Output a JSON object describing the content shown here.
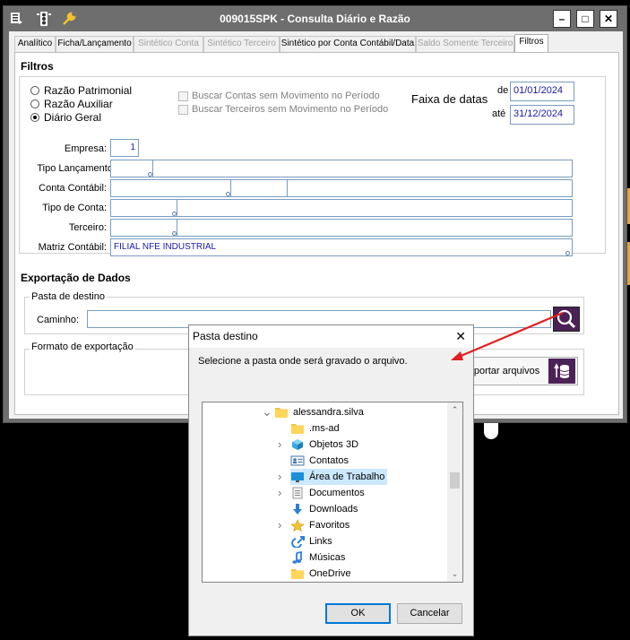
{
  "window": {
    "title": "009015SPK - Consulta Diário e Razão",
    "controls": {
      "minimize": "–",
      "maximize": "□",
      "close": "✕"
    }
  },
  "tabs": [
    {
      "label": "Analítico",
      "state": "enabled"
    },
    {
      "label": "Ficha/Lançamento",
      "state": "enabled"
    },
    {
      "label": "Sintético Conta",
      "state": "disabled"
    },
    {
      "label": "Sintético Terceiro",
      "state": "disabled"
    },
    {
      "label": "Sintético por Conta Contábil/Data",
      "state": "enabled"
    },
    {
      "label": "Saldo Somente Terceiro",
      "state": "disabled"
    },
    {
      "label": "Filtros",
      "state": "active"
    }
  ],
  "filtros": {
    "section_title": "Filtros",
    "radios": [
      {
        "label": "Razão Patrimonial",
        "checked": false
      },
      {
        "label": "Razão Auxiliar",
        "checked": false
      },
      {
        "label": "Diário Geral",
        "checked": true
      }
    ],
    "checkboxes": [
      {
        "label": "Buscar Contas sem Movimento no Período",
        "checked": false
      },
      {
        "label": "Buscar Terceiros sem Movimento no Período",
        "checked": false
      }
    ],
    "date_range": {
      "label": "Faixa de datas",
      "from_label": "de",
      "from_value": "01/01/2024",
      "to_label": "até",
      "to_value": "31/12/2024"
    },
    "fields": {
      "empresa": {
        "label": "Empresa:",
        "value": "1"
      },
      "tipo_lancamento": {
        "label": "Tipo Lançamento:",
        "value": ""
      },
      "conta_contabil": {
        "label": "Conta Contábil:",
        "value": ""
      },
      "tipo_conta": {
        "label": "Tipo de Conta:",
        "value": ""
      },
      "terceiro": {
        "label": "Terceiro:",
        "value": ""
      },
      "matriz_contabil": {
        "label": "Matriz Contábil:",
        "value": "FILIAL NFE INDUSTRIAL"
      }
    }
  },
  "exportacao": {
    "section_title": "Exportação de Dados",
    "pasta_destino": {
      "legend": "Pasta de destino",
      "caminho_label": "Caminho:",
      "caminho_value": "",
      "browse_icon": "magnifier-icon"
    },
    "formato": {
      "legend": "Formato de exportação",
      "button_label": "Exportar arquivos",
      "button_icon": "database-export-icon"
    }
  },
  "dialog": {
    "title": "Pasta destino",
    "close": "✕",
    "message": "Selecione a pasta onde será gravado o arquivo.",
    "tree": [
      {
        "label": "alessandra.silva",
        "icon": "folder-icon",
        "expanded": true,
        "selected": false
      },
      {
        "label": ".ms-ad",
        "icon": "folder-icon",
        "expanded": false,
        "selected": false
      },
      {
        "label": "Objetos 3D",
        "icon": "3d-objects-icon",
        "expanded": false,
        "selected": false
      },
      {
        "label": "Contatos",
        "icon": "contacts-icon",
        "expanded": false,
        "selected": false
      },
      {
        "label": "Área de Trabalho",
        "icon": "desktop-icon",
        "expanded": false,
        "selected": true
      },
      {
        "label": "Documentos",
        "icon": "documents-icon",
        "expanded": false,
        "selected": false
      },
      {
        "label": "Downloads",
        "icon": "downloads-icon",
        "expanded": false,
        "selected": false
      },
      {
        "label": "Favoritos",
        "icon": "favorites-icon",
        "expanded": false,
        "selected": false
      },
      {
        "label": "Links",
        "icon": "links-icon",
        "expanded": false,
        "selected": false
      },
      {
        "label": "Músicas",
        "icon": "music-icon",
        "expanded": false,
        "selected": false
      },
      {
        "label": "OneDrive",
        "icon": "folder-icon",
        "expanded": false,
        "selected": false
      }
    ],
    "ok_label": "OK",
    "cancel_label": "Cancelar"
  },
  "colors": {
    "accent_arrow": "#e02020",
    "titlebar": "#6e6e6e",
    "selection": "#cce8ff",
    "field_text": "#1a1aa6",
    "export_button_icon_bg": "#4b2256"
  }
}
